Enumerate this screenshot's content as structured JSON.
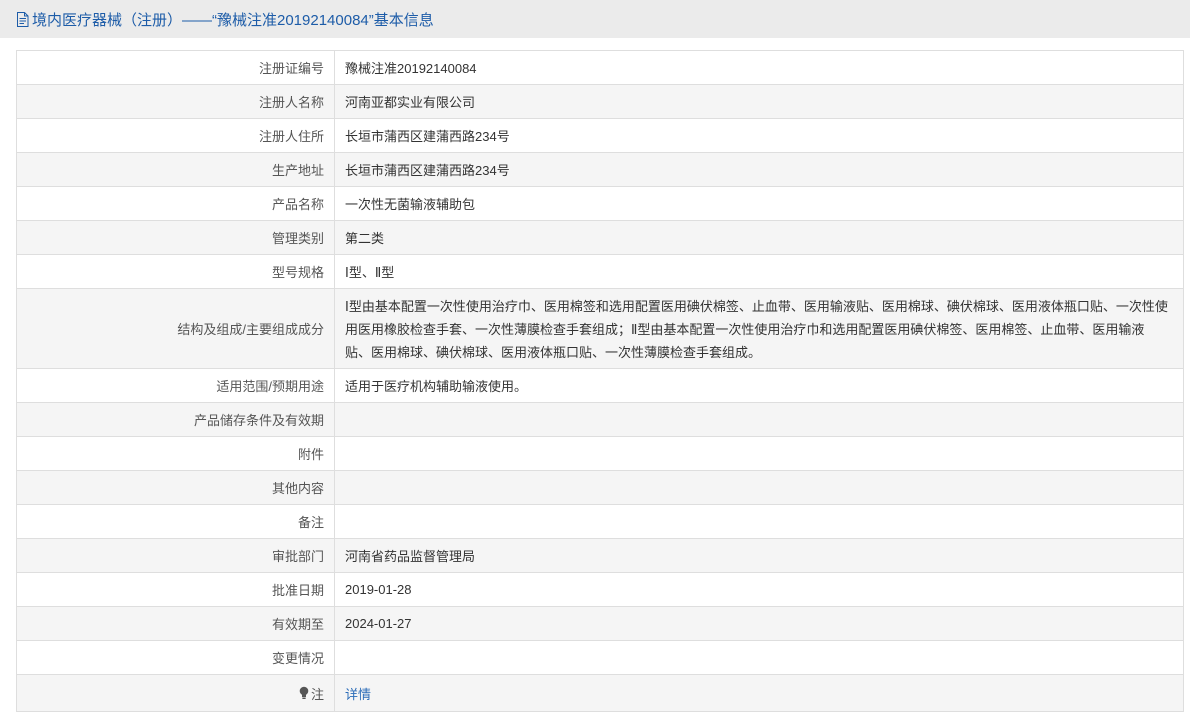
{
  "header": {
    "title": "境内医疗器械（注册）——“豫械注准20192140084”基本信息",
    "icon": "document-icon"
  },
  "rows": [
    {
      "label": "注册证编号",
      "value": "豫械注准20192140084"
    },
    {
      "label": "注册人名称",
      "value": "河南亚都实业有限公司"
    },
    {
      "label": "注册人住所",
      "value": "长垣市蒲西区建蒲西路234号"
    },
    {
      "label": "生产地址",
      "value": "长垣市蒲西区建蒲西路234号"
    },
    {
      "label": "产品名称",
      "value": "一次性无菌输液辅助包"
    },
    {
      "label": "管理类别",
      "value": "第二类"
    },
    {
      "label": "型号规格",
      "value": "Ⅰ型、Ⅱ型"
    },
    {
      "label": "结构及组成/主要组成成分",
      "value": "Ⅰ型由基本配置一次性使用治疗巾、医用棉签和选用配置医用碘伏棉签、止血带、医用输液贴、医用棉球、碘伏棉球、医用液体瓶口贴、一次性使用医用橡胶检查手套、一次性薄膜检查手套组成；Ⅱ型由基本配置一次性使用治疗巾和选用配置医用碘伏棉签、医用棉签、止血带、医用输液贴、医用棉球、碘伏棉球、医用液体瓶口贴、一次性薄膜检查手套组成。"
    },
    {
      "label": "适用范围/预期用途",
      "value": "适用于医疗机构辅助输液使用。"
    },
    {
      "label": "产品储存条件及有效期",
      "value": ""
    },
    {
      "label": "附件",
      "value": ""
    },
    {
      "label": "其他内容",
      "value": ""
    },
    {
      "label": "备注",
      "value": ""
    },
    {
      "label": "审批部门",
      "value": "河南省药品监督管理局"
    },
    {
      "label": "批准日期",
      "value": "2019-01-28"
    },
    {
      "label": "有效期至",
      "value": "2024-01-27"
    },
    {
      "label": "变更情况",
      "value": ""
    }
  ],
  "note": {
    "label": "注",
    "link_text": "详情",
    "icon": "lightbulb-icon"
  },
  "colors": {
    "title": "#1d5ca8",
    "link": "#2b6cb8",
    "header_bg": "#ebebeb",
    "row_alt_bg": "#f5f5f5",
    "border": "#dedede",
    "label_text": "#555555",
    "value_text": "#333333"
  }
}
